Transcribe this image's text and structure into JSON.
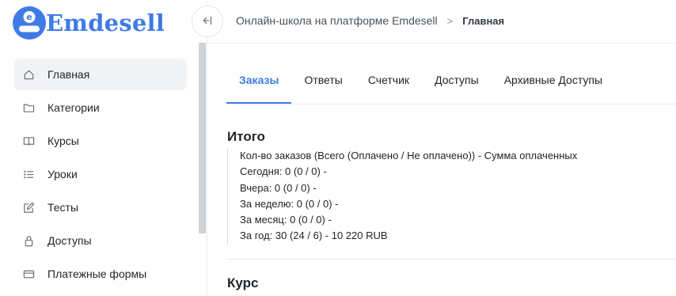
{
  "brand": {
    "name": "Emdesell",
    "logo_letter": "e",
    "color": "#3f7be6"
  },
  "sidebar": {
    "items": [
      {
        "label": "Главная",
        "icon": "home-icon",
        "active": true
      },
      {
        "label": "Категории",
        "icon": "folder-icon",
        "active": false
      },
      {
        "label": "Курсы",
        "icon": "book-icon",
        "active": false
      },
      {
        "label": "Уроки",
        "icon": "list-icon",
        "active": false
      },
      {
        "label": "Тесты",
        "icon": "edit-icon",
        "active": false
      },
      {
        "label": "Доступы",
        "icon": "lock-icon",
        "active": false
      },
      {
        "label": "Платежные формы",
        "icon": "credit-card-icon",
        "active": false
      }
    ]
  },
  "topbar": {
    "collapse_icon": "collapse-sidebar-icon",
    "breadcrumb": {
      "parent": "Онлайн-школа на платформе Emdesell",
      "separator": ">",
      "current": "Главная"
    }
  },
  "tabs": [
    {
      "label": "Заказы",
      "active": true
    },
    {
      "label": "Ответы",
      "active": false
    },
    {
      "label": "Счетчик",
      "active": false
    },
    {
      "label": "Доступы",
      "active": false
    },
    {
      "label": "Архивные Доступы",
      "active": false
    }
  ],
  "summary": {
    "title": "Итого",
    "lines": [
      "Кол-во заказов (Всего (Оплачено / Не оплачено)) - Сумма оплаченных",
      "Сегодня: 0 (0 / 0) -",
      "Вчера: 0 (0 / 0) -",
      "За неделю: 0 (0 / 0) -",
      "За месяц: 0 (0 / 0) -",
      "За год: 30 (24 / 6) - 10 220 RUB"
    ]
  },
  "course": {
    "title": "Курс"
  }
}
